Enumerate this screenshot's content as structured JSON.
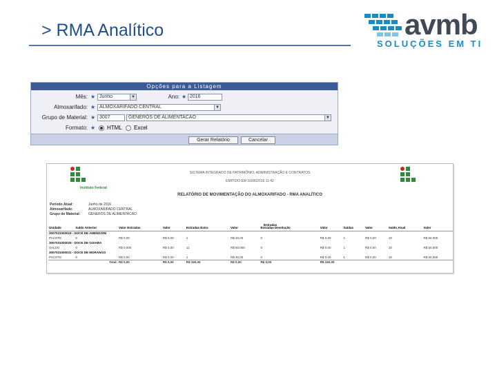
{
  "slide": {
    "title": "> RMA Analítico"
  },
  "logo": {
    "name": "avmb",
    "tagline": "SOLUÇÕES EM TI",
    "accent": "#1a8cc4",
    "dark": "#404a54"
  },
  "form": {
    "caption": "Opções para a Listagem",
    "mes": {
      "label": "Mês:",
      "value": "Junho"
    },
    "ano": {
      "label": "Ano:",
      "value": "2016"
    },
    "almoxarifado": {
      "label": "Almoxarifado:",
      "value": "ALMOXARIFADO CENTRAL"
    },
    "grupo": {
      "label": "Grupo de Material:",
      "code": "3007",
      "value": "GENEROS DE ALIMENTACAO"
    },
    "formato": {
      "label": "Formato:",
      "html": "HTML",
      "excel": "Excel",
      "selected": "HTML"
    },
    "buttons": {
      "generate": "Gerar Relatório",
      "cancel": "Cancelar"
    }
  },
  "report": {
    "system": "SISTEMA INTEGRADO DE PATRIMÔNIO, ADMINISTRAÇÃO E CONTRATOS",
    "emitted": "EMITIDO EM 16/06/2016 11:42",
    "campus": "Instituto Federal",
    "title": "RELATÓRIO DE MOVIMENTAÇÃO DO ALMOXARIFADO - RMA ANALÍTICO",
    "periodo": {
      "label": "Período Atual:",
      "value": "Junho de 2016"
    },
    "almoxarifado": {
      "label": "Almoxarifado:",
      "value": "ALMOXARIFADO CENTRAL"
    },
    "grupo": {
      "label": "Grupo de Material:",
      "value": "GENEROS DE ALIMENTACAO"
    },
    "columns": [
      "Unidade",
      "Saldo Anterior",
      "Valor Entradas",
      "Valor",
      "Entradas Extra",
      "Valor",
      "Entradas Devolução",
      "Valor",
      "Saídas",
      "Valor",
      "Saldo Atual",
      "Valor"
    ],
    "group_header": "Entradas",
    "rows": [
      {
        "type": "grp",
        "label": "3007031000019 - DOCE DE AMENDOIM"
      },
      {
        "type": "data",
        "cells": [
          "PACOTE",
          "0",
          "R$ 0,00",
          "R$ 0,00",
          "1",
          "R$ 20,00",
          "0",
          "R$ 0,00",
          "1",
          "R$ 0,00",
          "10",
          "R$ 50,000"
        ]
      },
      {
        "type": "grp",
        "label": "3007031000029 - DOCE DE GOIABA"
      },
      {
        "type": "data",
        "cells": [
          "SALDO",
          "0",
          "R$ 0,000",
          "R$ 0,00",
          "11",
          "R$ 50,000",
          "0",
          "R$ 0,00",
          "1",
          "R$ 0,00",
          "10",
          "R$ 50,000"
        ]
      },
      {
        "type": "grp",
        "label": "3007031000031 - DOCE DE MORANGO"
      },
      {
        "type": "data",
        "cells": [
          "PACOTE",
          "0",
          "R$ 0,00",
          "R$ 0,00",
          "1",
          "R$ 30,00",
          "0",
          "R$ 0,00",
          "1",
          "R$ 0,00",
          "10",
          "R$ 50,000"
        ]
      }
    ],
    "total": {
      "label": "Total:",
      "values": [
        "R$ 0,00",
        "R$ 0,00",
        "R$ 150,00",
        "R$ 0,00",
        "R$ 0,00",
        "R$ 150,00"
      ]
    }
  }
}
